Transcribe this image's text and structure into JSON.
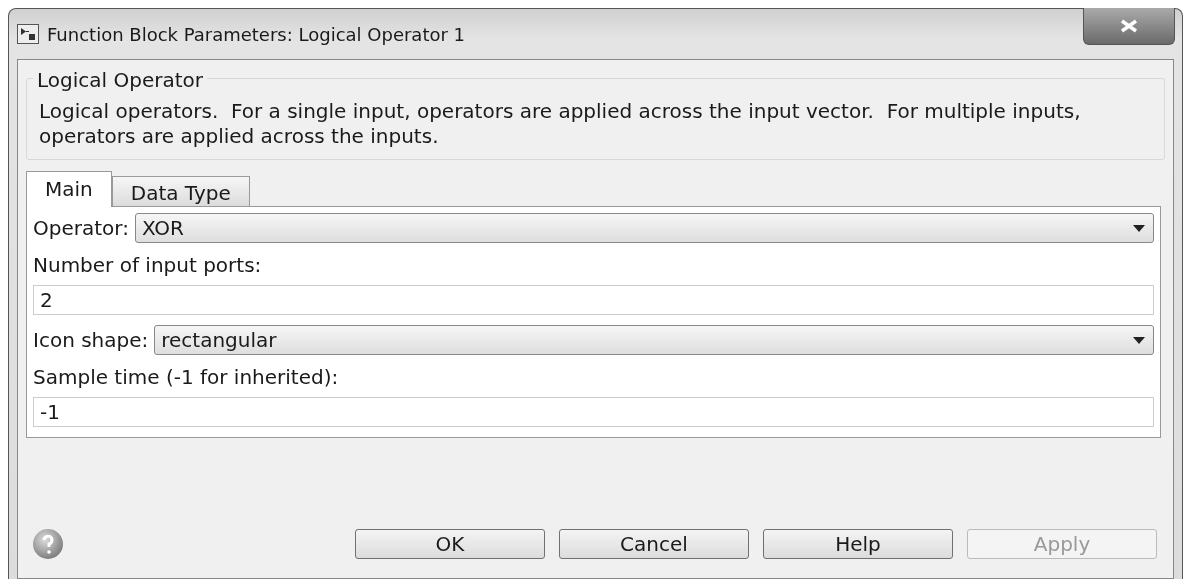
{
  "window": {
    "title": "Function Block Parameters: Logical Operator 1"
  },
  "group": {
    "title": "Logical Operator",
    "description": "Logical operators.  For a single input, operators are applied across the input vector.  For multiple inputs, operators are applied across the inputs."
  },
  "tabs": [
    {
      "label": "Main",
      "selected": true
    },
    {
      "label": "Data Type",
      "selected": false
    }
  ],
  "parameters": [
    {
      "kind": "dropdown",
      "label": "Operator:",
      "value": "XOR"
    },
    {
      "kind": "text",
      "label": "Number of input ports:",
      "value": "2"
    },
    {
      "kind": "dropdown",
      "label": "Icon shape:",
      "value": "rectangular"
    },
    {
      "kind": "text",
      "label": "Sample time (-1 for inherited):",
      "value": "-1"
    }
  ],
  "buttons": [
    {
      "label": "OK",
      "disabled": false
    },
    {
      "label": "Cancel",
      "disabled": false
    },
    {
      "label": "Help",
      "disabled": false
    },
    {
      "label": "Apply",
      "disabled": true
    }
  ]
}
